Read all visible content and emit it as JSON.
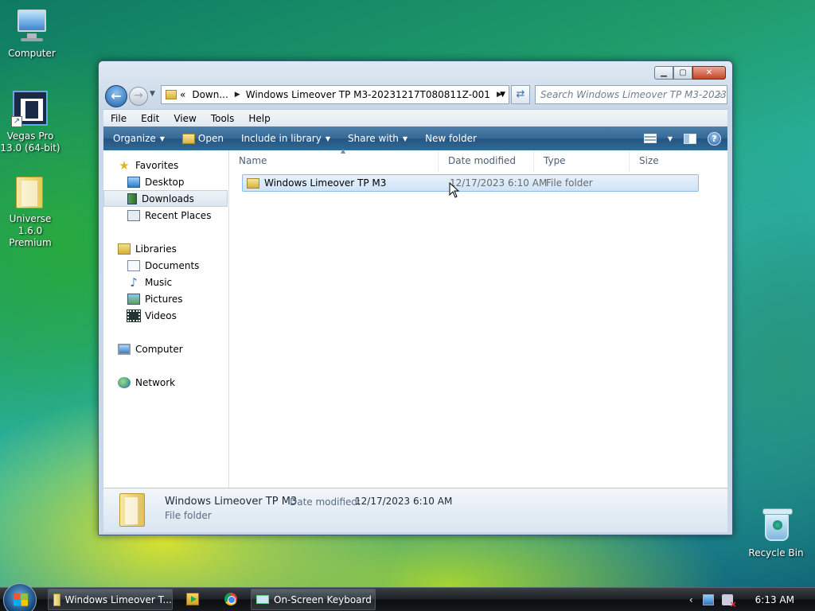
{
  "desktop": {
    "icons": [
      {
        "label": "Computer"
      },
      {
        "label": "Vegas Pro 13.0 (64-bit)"
      },
      {
        "label": "Universe 1.6.0 Premium"
      },
      {
        "label": "Recycle Bin"
      }
    ]
  },
  "window": {
    "title_buttons": {
      "minimize": "▁",
      "maximize": "▢",
      "close": "✕"
    },
    "address": {
      "overflow": "«",
      "crumbs": [
        "Down...",
        "Windows Limeover TP M3-20231217T080811Z-001"
      ]
    },
    "search": {
      "placeholder": "Search Windows Limeover TP M3-2023..."
    },
    "menu": [
      "File",
      "Edit",
      "View",
      "Tools",
      "Help"
    ],
    "commands": {
      "organize": "Organize",
      "open": "Open",
      "include": "Include in library",
      "share": "Share with",
      "new_folder": "New folder",
      "help": "?"
    },
    "nav": {
      "favorites": "Favorites",
      "desktop": "Desktop",
      "downloads": "Downloads",
      "recent": "Recent Places",
      "libraries": "Libraries",
      "documents": "Documents",
      "music": "Music",
      "pictures": "Pictures",
      "videos": "Videos",
      "computer": "Computer",
      "network": "Network"
    },
    "columns": {
      "name": "Name",
      "date": "Date modified",
      "type": "Type",
      "size": "Size"
    },
    "files": [
      {
        "name": "Windows Limeover TP M3",
        "date": "12/17/2023 6:10 AM",
        "type": "File folder"
      }
    ],
    "details": {
      "name": "Windows Limeover TP M3",
      "date_label": "Date modified:",
      "date_value": "12/17/2023 6:10 AM",
      "type": "File folder"
    }
  },
  "taskbar": {
    "explorer": "Windows Limeover T...",
    "keyboard": "On-Screen Keyboard",
    "clock": "6:13 AM",
    "tray_chevron": "‹"
  },
  "colors": {
    "command_bar": "#2f6b96",
    "selection": "#cfe4f8",
    "taskbar": "#16191d"
  }
}
